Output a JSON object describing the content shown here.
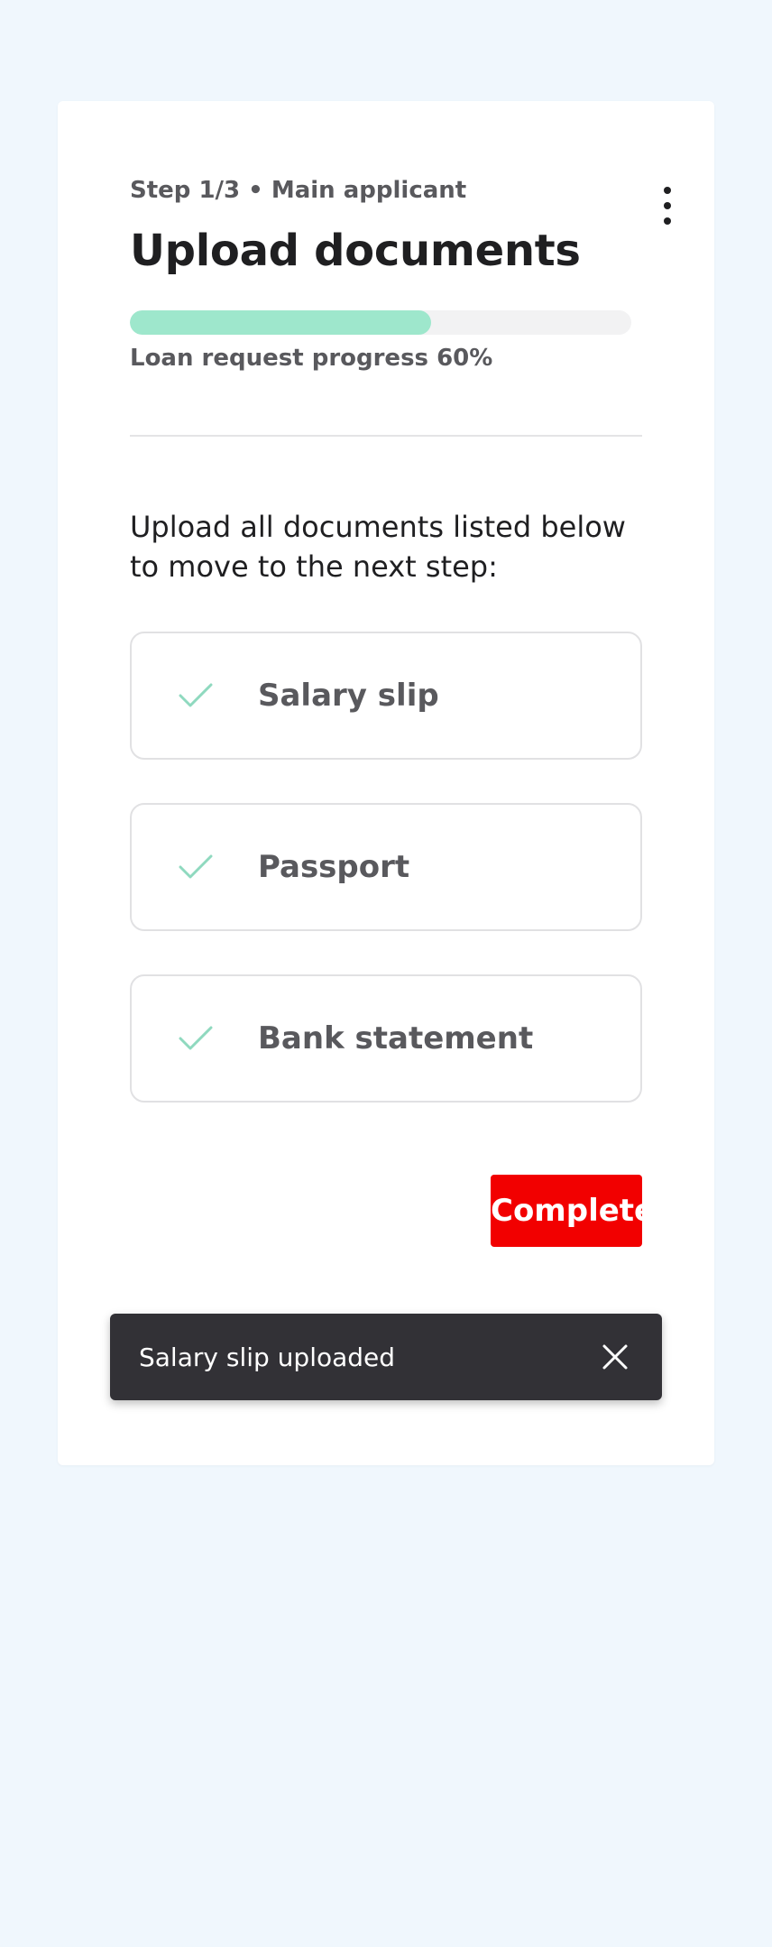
{
  "header": {
    "step_label": "Step 1/3 • Main applicant",
    "title": "Upload documents",
    "menu_icon": "kebab-menu-icon"
  },
  "progress": {
    "label": "Loan request progress 60%",
    "value_percent": 60,
    "fill_color": "#9ee7cc"
  },
  "instructions": "Upload all documents listed below to move to the next step:",
  "documents": [
    {
      "label": "Salary slip",
      "icon": "check-icon",
      "status": "uploaded"
    },
    {
      "label": "Passport",
      "icon": "check-icon",
      "status": "uploaded"
    },
    {
      "label": "Bank statement",
      "icon": "check-icon",
      "status": "uploaded"
    }
  ],
  "actions": {
    "complete_label": "Complete",
    "complete_color": "#f20000"
  },
  "toast": {
    "message": "Salary slip uploaded",
    "close_icon": "close-icon"
  }
}
